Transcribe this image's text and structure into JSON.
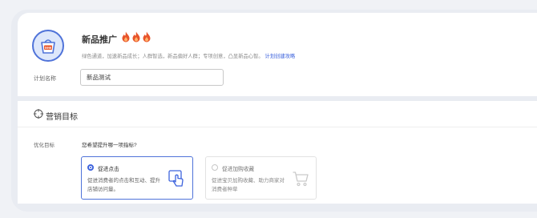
{
  "plan": {
    "title": "新品推广",
    "flame_count": 3,
    "description": "绿色通道，加速新品成长；人群智选，新品偏好人群；专项创意，凸显新品心智。",
    "guide_link": "计划创建攻略",
    "name_label": "计划名称",
    "name_value": "新品测试",
    "icon_badge": "new"
  },
  "marketing": {
    "section_title": "营销目标",
    "optimize_label": "优化目标",
    "question": "您希望提升哪一项指标?",
    "options": [
      {
        "title": "促进点击",
        "description": "促进消费者的点击和互动、提升店铺访问量。",
        "selected": true,
        "icon": "hand-click-icon"
      },
      {
        "title": "促进加购收藏",
        "description": "促进宝贝加购收藏、助力商家对消费者种草",
        "selected": false,
        "icon": "shopping-cart-icon"
      }
    ]
  },
  "colors": {
    "accent": "#3d63dd",
    "flame": "#e8542a"
  }
}
